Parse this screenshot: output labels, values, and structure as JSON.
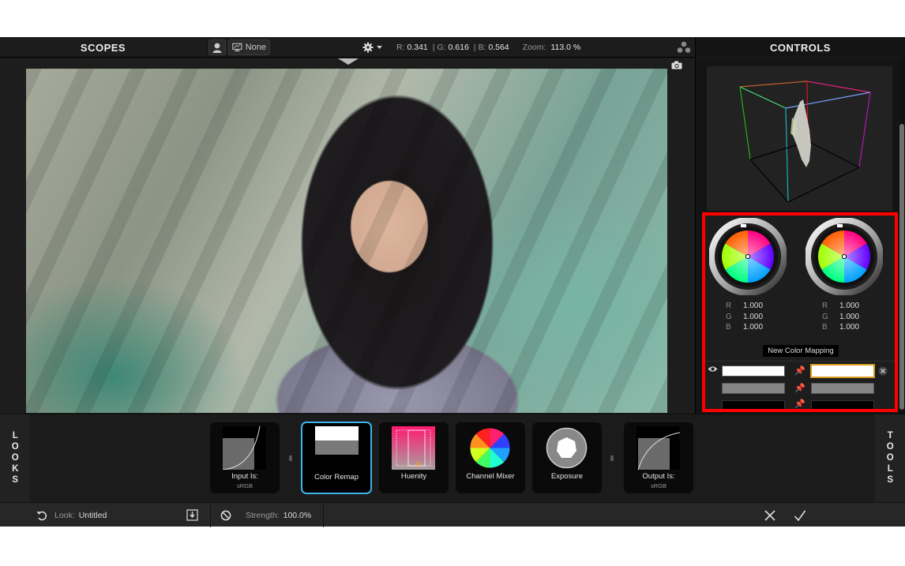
{
  "topbar": {
    "scopes_title": "SCOPES",
    "controls_title": "CONTROLS",
    "compare_label": "None",
    "readout": {
      "r_label": "R:",
      "r_value": "0.341",
      "g_label": "| G:",
      "g_value": "0.616",
      "b_label": "| B:",
      "b_value": "0.564",
      "zoom_label": "Zoom:",
      "zoom_value": "113.0 %"
    }
  },
  "controls": {
    "source_color": {
      "r_label": "R",
      "r": "1.000",
      "g_label": "G",
      "g": "1.000",
      "b_label": "B",
      "b": "1.000"
    },
    "target_color": {
      "r_label": "R",
      "r": "1.000",
      "g_label": "G",
      "g": "1.000",
      "b_label": "B",
      "b": "1.000"
    },
    "new_mapping_label": "New Color Mapping",
    "mappings": [
      {
        "source": "#ffffff",
        "target": "#ffffff",
        "selected": true
      },
      {
        "source": "#858585",
        "target": "#858585",
        "selected": false
      },
      {
        "source": "#000000",
        "target": "#000000",
        "selected": false
      }
    ],
    "highlight_color": "#ff0000",
    "selected_outline_color": "#d79a1e"
  },
  "strip": {
    "looks_tab": "LOOKS",
    "tools_tab": "TOOLS",
    "tiles": [
      {
        "label": "Input Is:",
        "sub": "sRGB"
      },
      {
        "label": "Color Remap",
        "sub": ""
      },
      {
        "label": "Huenity",
        "sub": ""
      },
      {
        "label": "Channel Mixer",
        "sub": ""
      },
      {
        "label": "Exposure",
        "sub": ""
      },
      {
        "label": "Output Is:",
        "sub": "sRGB"
      }
    ],
    "selected_tile": "Color Remap",
    "accent": "#3bb6ea"
  },
  "status": {
    "look_label": "Look:",
    "look_value": "Untitled",
    "strength_label": "Strength:",
    "strength_value": "100.0%"
  }
}
